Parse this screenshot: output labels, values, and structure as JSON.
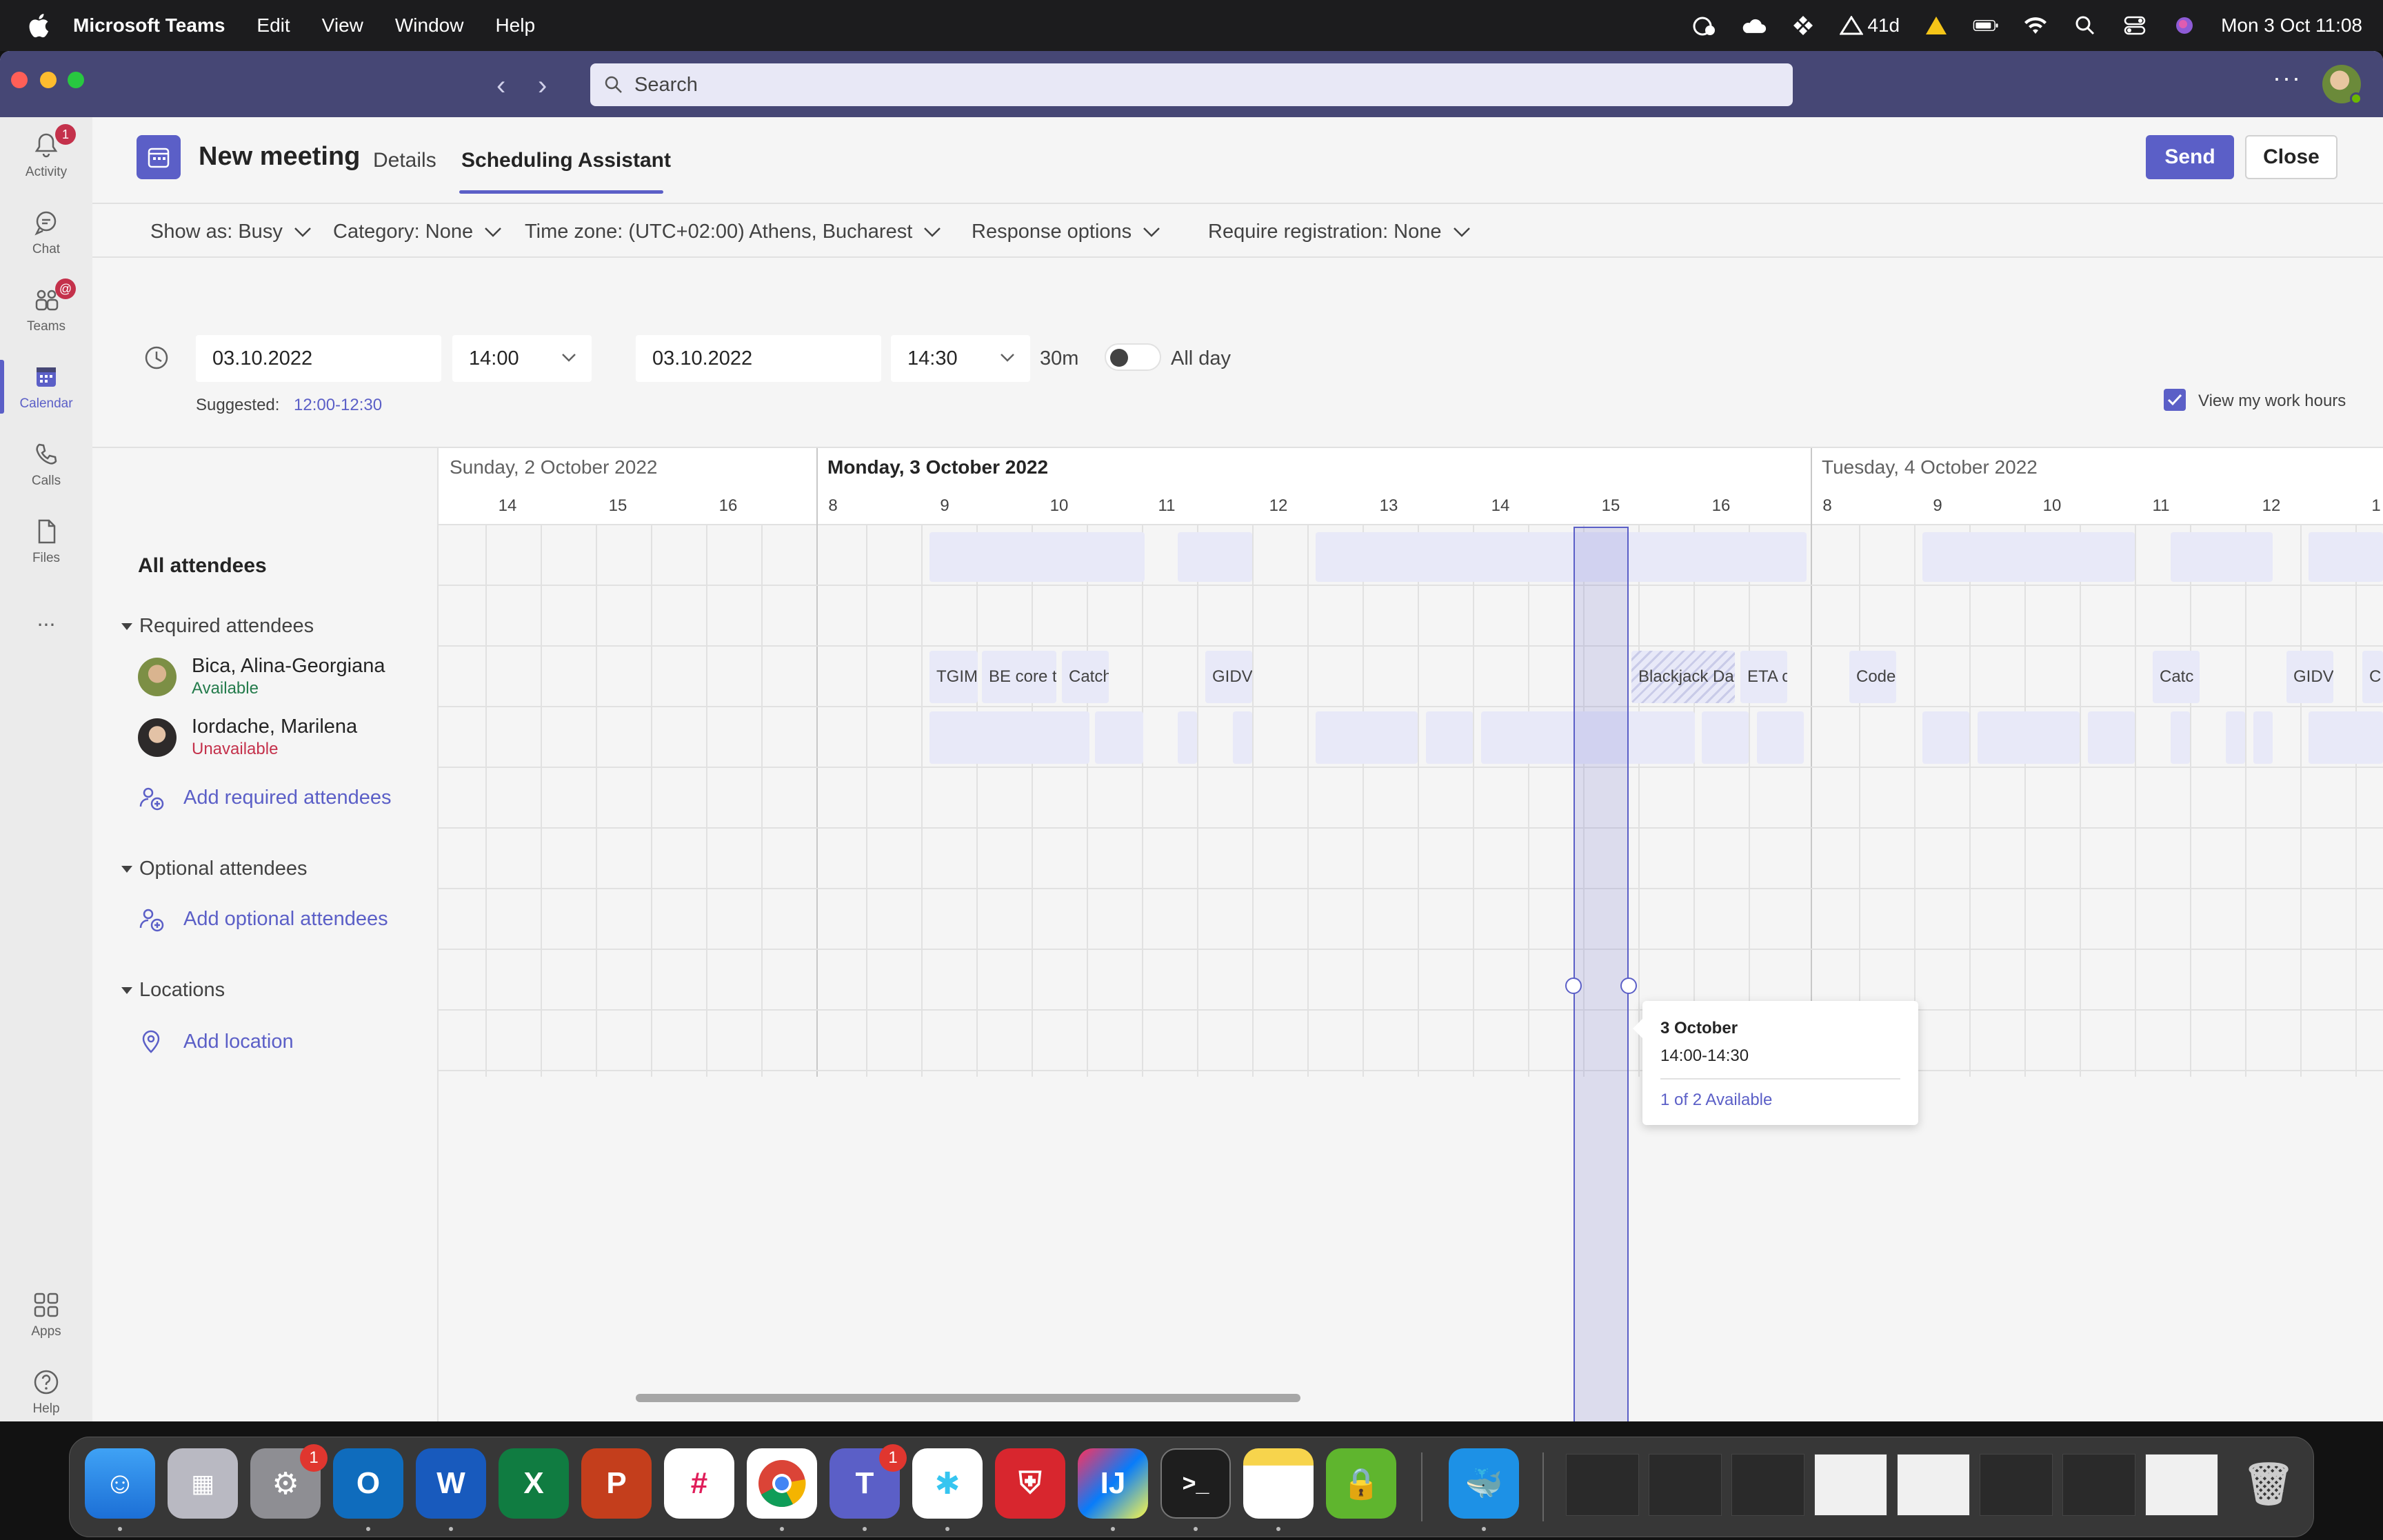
{
  "menubar": {
    "app_name": "Microsoft Teams",
    "items": [
      "Edit",
      "View",
      "Window",
      "Help"
    ],
    "battery_text": "41d",
    "datetime": "Mon 3 Oct  11:08"
  },
  "titlebar": {
    "search_placeholder": "Search",
    "more": "···"
  },
  "rail": {
    "items": [
      {
        "label": "Activity",
        "icon": "bell-icon",
        "badge": "1"
      },
      {
        "label": "Chat",
        "icon": "chat-icon"
      },
      {
        "label": "Teams",
        "icon": "teams-icon",
        "badge": "@"
      },
      {
        "label": "Calendar",
        "icon": "calendar-icon",
        "active": true
      },
      {
        "label": "Calls",
        "icon": "phone-icon"
      },
      {
        "label": "Files",
        "icon": "file-icon"
      },
      {
        "label": "...",
        "icon": "more-icon"
      }
    ],
    "bottom": [
      {
        "label": "Apps",
        "icon": "apps-icon"
      },
      {
        "label": "Help",
        "icon": "help-icon"
      }
    ]
  },
  "header": {
    "title": "New meeting",
    "tabs": [
      "Details",
      "Scheduling Assistant"
    ],
    "active_tab": "Scheduling Assistant",
    "send_label": "Send",
    "close_label": "Close"
  },
  "options": {
    "show_as": "Show as: Busy",
    "category": "Category: None",
    "time_zone": "Time zone:  (UTC+02:00) Athens, Bucharest",
    "response": "Response options",
    "registration": "Require registration: None"
  },
  "datetime": {
    "start_date": "03.10.2022",
    "start_time": "14:00",
    "end_date": "03.10.2022",
    "end_time": "14:30",
    "duration": "30m",
    "all_day_label": "All day",
    "all_day": false,
    "suggested_label": "Suggested:",
    "suggested_value": "12:00-12:30",
    "work_hours_label": "View my work hours",
    "work_hours_checked": true
  },
  "attendees": {
    "all_label": "All attendees",
    "required_label": "Required attendees",
    "required": [
      {
        "name": "Bica, Alina-Georgiana",
        "status": "Available",
        "status_color": "#237b4b"
      },
      {
        "name": "Iordache, Marilena",
        "status": "Unavailable",
        "status_color": "#c4314b"
      }
    ],
    "add_required": "Add required attendees",
    "optional_label": "Optional attendees",
    "add_optional": "Add optional attendees",
    "locations_label": "Locations",
    "add_location": "Add location"
  },
  "grid": {
    "days": [
      {
        "label": "Sunday, 2 October 2022",
        "today": false
      },
      {
        "label": "Monday, 3 October 2022",
        "today": true
      },
      {
        "label": "Tuesday, 4 October 2022",
        "today": false
      }
    ],
    "hours_sun": [
      "14",
      "15",
      "16"
    ],
    "hours_mon": [
      "8",
      "9",
      "10",
      "11",
      "12",
      "13",
      "14",
      "15",
      "16"
    ],
    "hours_tue": [
      "8",
      "9",
      "10",
      "11",
      "12",
      "1"
    ],
    "events_bica": [
      "TGIM",
      "BE core t",
      "Catch",
      "GIDV",
      "Blackjack Da",
      "ETA c",
      "Code",
      "Catc",
      "GIDV",
      "C"
    ],
    "selection": {
      "start": "14:00",
      "end": "14:30"
    }
  },
  "tooltip": {
    "date": "3 October",
    "time": "14:00-14:30",
    "availability": "1 of 2 Available"
  },
  "dock": {
    "apps": [
      {
        "name": "Finder",
        "icon": "finder-icon"
      },
      {
        "name": "Launchpad",
        "icon": "launchpad-icon"
      },
      {
        "name": "System Preferences",
        "icon": "settings-icon",
        "badge": "1"
      },
      {
        "name": "Outlook",
        "icon": "outlook-icon"
      },
      {
        "name": "Word",
        "icon": "word-icon"
      },
      {
        "name": "Excel",
        "icon": "excel-icon"
      },
      {
        "name": "PowerPoint",
        "icon": "powerpoint-icon"
      },
      {
        "name": "Slack",
        "icon": "slack-icon"
      },
      {
        "name": "Chrome",
        "icon": "chrome-icon"
      },
      {
        "name": "Teams",
        "icon": "teams-icon",
        "badge": "1"
      },
      {
        "name": "Slack",
        "icon": "slack-icon"
      },
      {
        "name": "Security",
        "icon": "shield-icon"
      },
      {
        "name": "IntelliJ",
        "icon": "intellij-icon"
      },
      {
        "name": "Terminal",
        "icon": "terminal-icon"
      },
      {
        "name": "Notes",
        "icon": "notes-icon"
      },
      {
        "name": "Keychain",
        "icon": "lock-icon"
      },
      {
        "name": "Docker",
        "icon": "docker-icon"
      }
    ]
  }
}
